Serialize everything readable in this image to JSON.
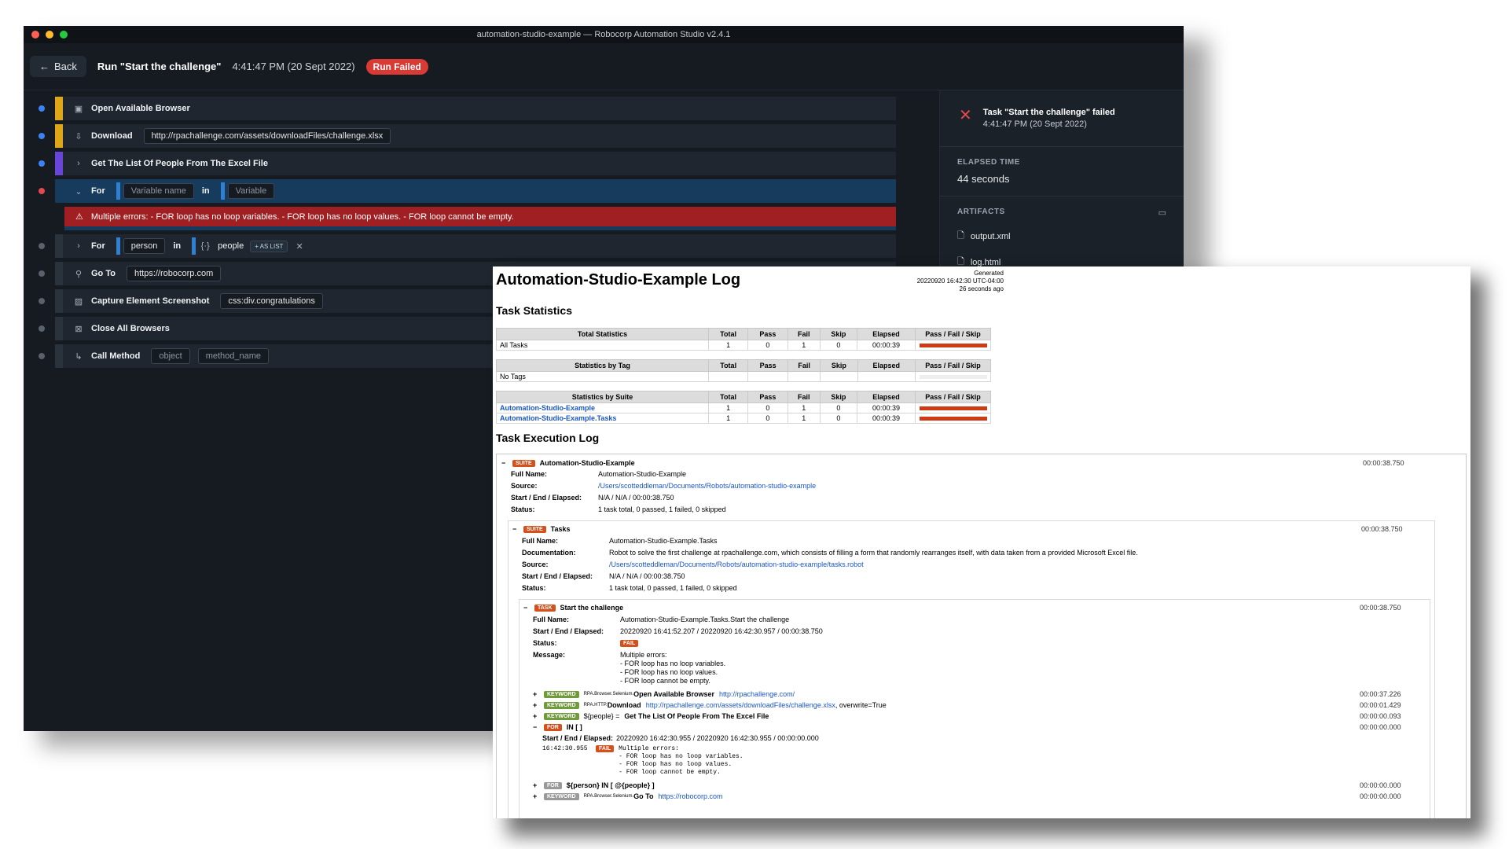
{
  "window": {
    "title": "automation-studio-example — Robocorp Automation Studio v2.4.1"
  },
  "header": {
    "back_label": "Back",
    "run_title": "Run \"Start the challenge\"",
    "run_time": "4:41:47 PM (20 Sept 2022)",
    "status_badge": "Run Failed"
  },
  "steps": {
    "open_browser": "Open Available Browser",
    "download": {
      "label": "Download",
      "value": "http://rpachallenge.com/assets/downloadFiles/challenge.xlsx"
    },
    "get_list": "Get The List Of People From The Excel File",
    "for_active": {
      "label": "For",
      "var_placeholder": "Variable name",
      "in": "in",
      "val_placeholder": "Variable"
    },
    "error": "Multiple errors: - FOR loop has no loop variables. - FOR loop has no loop values. - FOR loop cannot be empty.",
    "for_person": {
      "label": "For",
      "var": "person",
      "in": "in",
      "val": "people",
      "tag": "+ AS LIST"
    },
    "goto": {
      "label": "Go To",
      "value": "https://robocorp.com"
    },
    "capture": {
      "label": "Capture Element Screenshot",
      "value": "css:div.congratulations"
    },
    "close": "Close All Browsers",
    "call": {
      "label": "Call Method",
      "arg1": "object",
      "arg2": "method_name"
    }
  },
  "right_panel": {
    "fail_title": "Task \"Start the challenge\" failed",
    "fail_time": "4:41:47 PM (20 Sept 2022)",
    "elapsed_caption": "ELAPSED TIME",
    "elapsed_value": "44 seconds",
    "artifacts_caption": "ARTIFACTS",
    "artifacts": [
      "output.xml",
      "log.html"
    ]
  },
  "log": {
    "title": "Automation-Studio-Example Log",
    "generated": [
      "Generated",
      "20220920 16:42:30 UTC-04:00",
      "26 seconds ago"
    ],
    "task_stats_heading": "Task Statistics",
    "headers": [
      "Total",
      "Pass",
      "Fail",
      "Skip",
      "Elapsed",
      "Pass / Fail / Skip"
    ],
    "total_stats": {
      "title": "Total Statistics",
      "rows": [
        [
          "All Tasks",
          "1",
          "0",
          "1",
          "0",
          "00:00:39"
        ]
      ]
    },
    "tag_stats": {
      "title": "Statistics by Tag",
      "rows": [
        [
          "No Tags",
          "",
          "",
          "",
          "",
          ""
        ]
      ]
    },
    "suite_stats": {
      "title": "Statistics by Suite",
      "rows": [
        [
          "Automation-Studio-Example",
          "1",
          "0",
          "1",
          "0",
          "00:00:39"
        ],
        [
          "Automation-Studio-Example.Tasks",
          "1",
          "0",
          "1",
          "0",
          "00:00:39"
        ]
      ]
    },
    "exec_heading": "Task Execution Log",
    "suite1": {
      "tag": "SUITE",
      "name": "Automation-Studio-Example",
      "time": "00:00:38.750",
      "full_name_k": "Full Name:",
      "full_name": "Automation-Studio-Example",
      "source_k": "Source:",
      "source": "/Users/scotteddleman/Documents/Robots/automation-studio-example",
      "sed_k": "Start / End / Elapsed:",
      "sed": "N/A / N/A / 00:00:38.750",
      "status_k": "Status:",
      "status": "1 task total, 0 passed, 1 failed, 0 skipped"
    },
    "suite2": {
      "tag": "SUITE",
      "name": "Tasks",
      "time": "00:00:38.750",
      "full_name_k": "Full Name:",
      "full_name": "Automation-Studio-Example.Tasks",
      "doc_k": "Documentation:",
      "doc": "Robot to solve the first challenge at rpachallenge.com, which consists of filling a form that randomly rearranges itself, with data taken from a provided Microsoft Excel file.",
      "source_k": "Source:",
      "source": "/Users/scotteddleman/Documents/Robots/automation-studio-example/tasks.robot",
      "sed_k": "Start / End / Elapsed:",
      "sed": "N/A / N/A / 00:00:38.750",
      "status_k": "Status:",
      "status": "1 task total, 0 passed, 1 failed, 0 skipped"
    },
    "task": {
      "tag": "TASK",
      "name": "Start the challenge",
      "time": "00:00:38.750",
      "full_name_k": "Full Name:",
      "full_name": "Automation-Studio-Example.Tasks.Start the challenge",
      "sed_k": "Start / End / Elapsed:",
      "sed": "20220920 16:41:52.207 / 20220920 16:42:30.957 / 00:00:38.750",
      "status_k": "Status:",
      "status": "FAIL",
      "message_k": "Message:",
      "message": [
        "Multiple errors:",
        "- FOR loop has no loop variables.",
        "- FOR loop has no loop values.",
        "- FOR loop cannot be empty."
      ]
    },
    "kw1": {
      "tag": "KEYWORD",
      "lib": "RPA.Browser.Selenium.",
      "name": "Open Available Browser",
      "arg": "http://rpachallenge.com/",
      "time": "00:00:37.226"
    },
    "kw2": {
      "tag": "KEYWORD",
      "lib": "RPA.HTTP.",
      "name": "Download",
      "arg": "http://rpachallenge.com/assets/downloadFiles/challenge.xlsx",
      "arg2": ", overwrite=True",
      "time": "00:00:01.429"
    },
    "kw3": {
      "tag": "KEYWORD",
      "pre": "${people} =",
      "name": "Get The List Of People From The Excel File",
      "time": "00:00:00.093"
    },
    "for1": {
      "tag": "FOR",
      "name": "IN [ ]",
      "time": "00:00:00.000",
      "sed_k": "Start / End / Elapsed:",
      "sed": "20220920 16:42:30.955 / 20220920 16:42:30.955 / 00:00:00.000",
      "msg_time": "16:42:30.955",
      "msg_level": "FAIL",
      "msg": "Multiple errors:\n- FOR loop has no loop variables.\n- FOR loop has no loop values.\n- FOR loop cannot be empty."
    },
    "for2": {
      "tag": "FOR",
      "name": "${person} IN [ @{people} ]",
      "time": "00:00:00.000"
    },
    "kw4": {
      "tag": "KEYWORD",
      "lib": "RPA.Browser.Selenium.",
      "name": "Go To",
      "arg": "https://robocorp.com",
      "time": "00:00:00.000"
    }
  }
}
